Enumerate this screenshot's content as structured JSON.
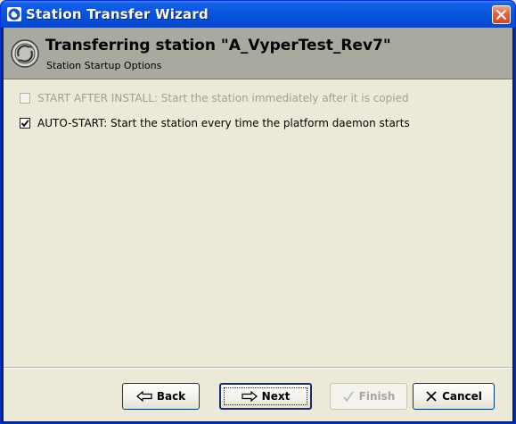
{
  "window": {
    "title": "Station Transfer Wizard"
  },
  "header": {
    "title": "Transferring station \"A_VyperTest_Rev7\"",
    "subtitle": "Station Startup Options"
  },
  "options": [
    {
      "label": "START AFTER INSTALL: Start the station immediately after it is copied",
      "checked": false,
      "enabled": false
    },
    {
      "label": "AUTO-START: Start the station every time the platform daemon starts",
      "checked": true,
      "enabled": true
    }
  ],
  "buttons": {
    "back": "Back",
    "next": "Next",
    "finish": "Finish",
    "cancel": "Cancel"
  },
  "colors": {
    "titlebar": "#0a56e0",
    "header_band": "#a9a99f",
    "dialog_bg": "#ece9d8",
    "disabled_text": "#9f9f97"
  },
  "icons": {
    "app": "station-wizard-logo-icon",
    "header": "station-transfer-icon",
    "close": "close-icon",
    "back": "arrow-left-icon",
    "next": "arrow-right-icon",
    "finish": "checkmark-icon",
    "cancel": "x-icon"
  }
}
